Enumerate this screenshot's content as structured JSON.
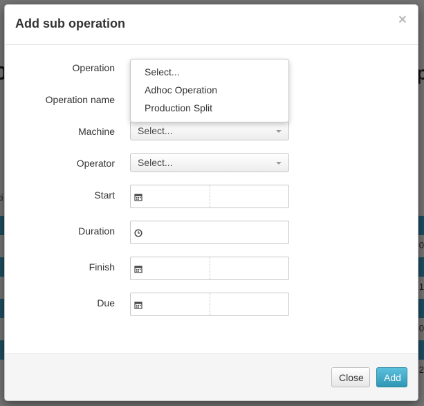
{
  "background": {
    "left_glyph": "0",
    "right_glyph": "p",
    "small_text": "ti",
    "row_fragments": [
      "0",
      "1",
      "0",
      "2"
    ]
  },
  "modal": {
    "title": "Add sub operation",
    "close_glyph": "×"
  },
  "form": {
    "operation": {
      "label": "Operation"
    },
    "operation_name": {
      "label": "Operation name"
    },
    "machine": {
      "label": "Machine",
      "value": "Select..."
    },
    "operator": {
      "label": "Operator",
      "value": "Select..."
    },
    "start": {
      "label": "Start",
      "icon": "calendar-icon"
    },
    "duration": {
      "label": "Duration",
      "icon": "clock-icon"
    },
    "finish": {
      "label": "Finish",
      "icon": "calendar-icon"
    },
    "due": {
      "label": "Due",
      "icon": "calendar-icon"
    }
  },
  "operation_dropdown": {
    "options": [
      "Select...",
      "Adhoc Operation",
      "Production Split"
    ]
  },
  "footer": {
    "close_label": "Close",
    "add_label": "Add"
  },
  "colors": {
    "primary_button": "#3fa9cf",
    "background_stripe": "#3a9ac0"
  }
}
